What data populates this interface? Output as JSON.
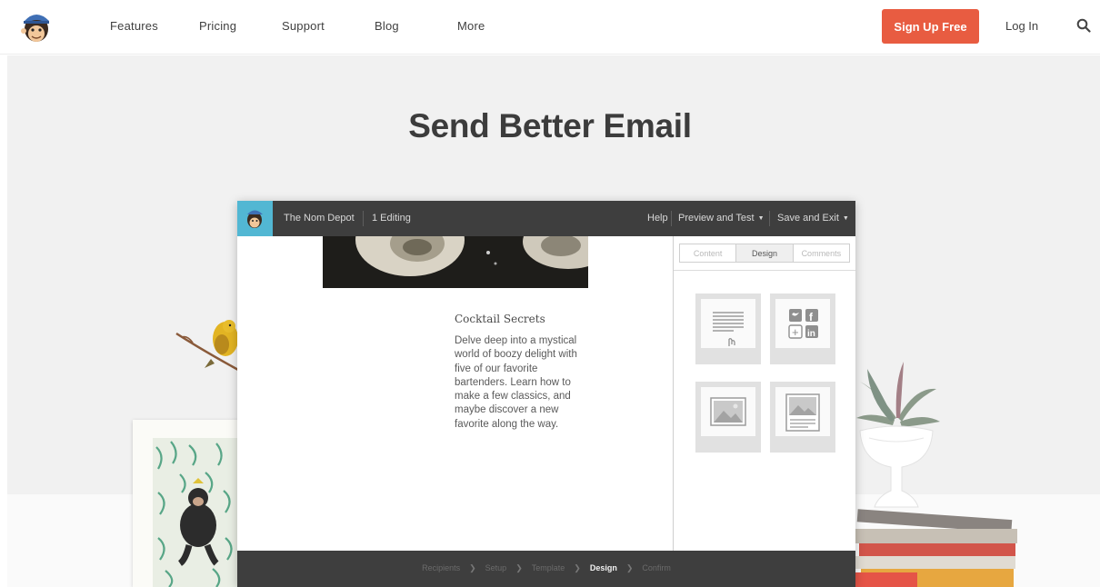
{
  "nav": {
    "items": [
      "Features",
      "Pricing",
      "Support",
      "Blog",
      "More"
    ],
    "signup_label": "Sign Up Free",
    "login_label": "Log In",
    "logo_icon": "mailchimp-monkey-icon",
    "search_icon": "search-icon",
    "accent": "#e85c41"
  },
  "hero": {
    "title": "Send Better Email"
  },
  "app": {
    "account_name": "The Nom Depot",
    "editing_label": "1 Editing",
    "help_label": "Help",
    "preview_label": "Preview and Test",
    "save_label": "Save and Exit",
    "article_title": "Cocktail Secrets",
    "article_body": "Delve deep into a mystical world of boozy delight with five of our favorite bartenders. Learn how to make a few classics, and maybe discover a new favorite along the way.",
    "tabs": [
      "Content",
      "Design",
      "Comments"
    ],
    "active_tab": "Design",
    "blocks": [
      "text-block-icon",
      "social-share-block-icon",
      "image-block-icon",
      "image-card-block-icon"
    ],
    "steps": [
      "Recipients",
      "Setup",
      "Template",
      "Design",
      "Confirm"
    ],
    "current_step": "Design"
  }
}
